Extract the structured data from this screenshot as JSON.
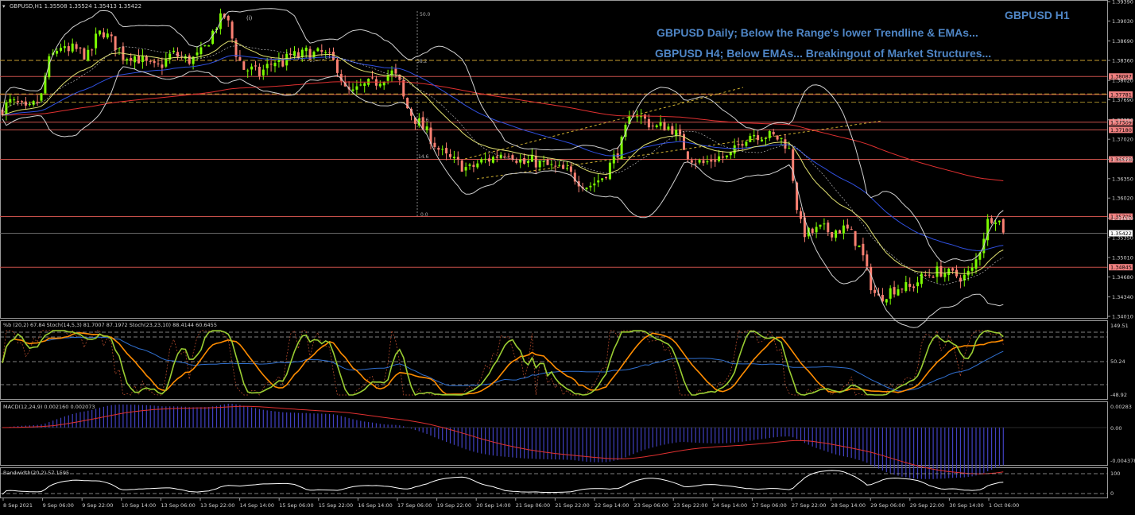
{
  "header": {
    "symbol_line": "GBPUSD,H1  1.35508 1.35524 1.35413 1.35422",
    "title_right": "GBPUSD H1",
    "annotation_1": "GBPUSD Daily; Below the Range's lower Trendline & EMAs...",
    "annotation_2": "GBPUSD H4; Below EMAs... Breakingout of Market Structures..."
  },
  "chart_data": [
    {
      "type": "candlestick",
      "name": "main",
      "ylim": [
        1.3401,
        1.3936
      ],
      "y_ticks": [
        1.3936,
        1.3903,
        1.3869,
        1.3836,
        1.3802,
        1.3769,
        1.3735,
        1.3702,
        1.3668,
        1.3635,
        1.3602,
        1.3568,
        1.3535,
        1.3501,
        1.3468,
        1.3434,
        1.3401
      ],
      "y_tick_labels": [
        "1.39390",
        "1.39030",
        "1.38690",
        "1.38360",
        "1.38020",
        "1.37690",
        "1.37350",
        "1.37020",
        "1.36680",
        "1.36350",
        "1.36020",
        "1.35680",
        "1.35350",
        "1.35010",
        "1.34680",
        "1.34340",
        "1.34010"
      ],
      "price_levels": [
        {
          "label": "1.38087",
          "value": 1.38087
        },
        {
          "label": "1.37781",
          "value": 1.37781
        },
        {
          "label": "1.37309",
          "value": 1.37309
        },
        {
          "label": "1.37180",
          "value": 1.3718
        },
        {
          "label": "1.36678",
          "value": 1.36678
        },
        {
          "label": "1.35705",
          "value": 1.35705
        },
        {
          "label": "1.34845",
          "value": 1.34845
        }
      ],
      "current_price": {
        "label": "1.35422",
        "value": 1.35422
      },
      "fib_labels": [
        "50.0",
        "38.2",
        "23.6",
        "14.6",
        "0.0"
      ],
      "swing_label": "(i)",
      "close_path": [
        [
          0,
          1.375
        ],
        [
          12,
          1.3765
        ],
        [
          24,
          1.376
        ],
        [
          34,
          1.3748
        ],
        [
          44,
          1.3762
        ],
        [
          52,
          1.3775
        ],
        [
          60,
          1.383
        ],
        [
          68,
          1.3848
        ],
        [
          76,
          1.3862
        ],
        [
          84,
          1.3846
        ],
        [
          92,
          1.3856
        ],
        [
          102,
          1.385
        ],
        [
          112,
          1.3842
        ],
        [
          122,
          1.3878
        ],
        [
          130,
          1.3885
        ],
        [
          138,
          1.3872
        ],
        [
          148,
          1.3858
        ],
        [
          156,
          1.3842
        ],
        [
          166,
          1.3846
        ],
        [
          176,
          1.3838
        ],
        [
          186,
          1.3828
        ],
        [
          196,
          1.3822
        ],
        [
          206,
          1.3832
        ],
        [
          216,
          1.3848
        ],
        [
          226,
          1.3842
        ],
        [
          236,
          1.3836
        ],
        [
          246,
          1.384
        ],
        [
          256,
          1.3852
        ],
        [
          266,
          1.388
        ],
        [
          274,
          1.39
        ],
        [
          282,
          1.3912
        ],
        [
          288,
          1.3895
        ],
        [
          296,
          1.3852
        ],
        [
          306,
          1.3822
        ],
        [
          316,
          1.382
        ],
        [
          326,
          1.3812
        ],
        [
          336,
          1.3825
        ],
        [
          346,
          1.3835
        ],
        [
          356,
          1.3832
        ],
        [
          366,
          1.3845
        ],
        [
          376,
          1.3842
        ],
        [
          386,
          1.385
        ],
        [
          396,
          1.3846
        ],
        [
          406,
          1.3848
        ],
        [
          416,
          1.3838
        ],
        [
          426,
          1.3822
        ],
        [
          434,
          1.3785
        ],
        [
          444,
          1.378
        ],
        [
          454,
          1.379
        ],
        [
          464,
          1.3795
        ],
        [
          474,
          1.38
        ],
        [
          484,
          1.381
        ],
        [
          494,
          1.3815
        ],
        [
          502,
          1.38
        ],
        [
          510,
          1.376
        ],
        [
          520,
          1.374
        ],
        [
          530,
          1.3725
        ],
        [
          540,
          1.3708
        ],
        [
          550,
          1.3688
        ],
        [
          560,
          1.3672
        ],
        [
          570,
          1.3665
        ],
        [
          580,
          1.3658
        ],
        [
          590,
          1.365
        ],
        [
          600,
          1.366
        ],
        [
          610,
          1.3666
        ],
        [
          620,
          1.367
        ],
        [
          630,
          1.3678
        ],
        [
          640,
          1.3682
        ],
        [
          650,
          1.367
        ],
        [
          660,
          1.366
        ],
        [
          670,
          1.3665
        ],
        [
          680,
          1.366
        ],
        [
          690,
          1.3656
        ],
        [
          700,
          1.3652
        ],
        [
          710,
          1.3648
        ],
        [
          720,
          1.364
        ],
        [
          730,
          1.363
        ],
        [
          740,
          1.3622
        ],
        [
          750,
          1.363
        ],
        [
          760,
          1.364
        ],
        [
          770,
          1.3665
        ],
        [
          780,
          1.3688
        ],
        [
          790,
          1.3728
        ],
        [
          798,
          1.3752
        ],
        [
          806,
          1.374
        ],
        [
          816,
          1.373
        ],
        [
          826,
          1.3722
        ],
        [
          836,
          1.3725
        ],
        [
          846,
          1.372
        ],
        [
          856,
          1.37
        ],
        [
          866,
          1.3675
        ],
        [
          876,
          1.3665
        ],
        [
          886,
          1.366
        ],
        [
          896,
          1.3668
        ],
        [
          906,
          1.3672
        ],
        [
          916,
          1.367
        ],
        [
          926,
          1.3685
        ],
        [
          936,
          1.3705
        ],
        [
          946,
          1.3712
        ],
        [
          956,
          1.371
        ],
        [
          966,
          1.3708
        ],
        [
          976,
          1.3705
        ],
        [
          986,
          1.37
        ],
        [
          994,
          1.368
        ],
        [
          1000,
          1.361
        ],
        [
          1006,
          1.356
        ],
        [
          1014,
          1.354
        ],
        [
          1024,
          1.3545
        ],
        [
          1034,
          1.355
        ],
        [
          1044,
          1.3545
        ],
        [
          1054,
          1.3548
        ],
        [
          1064,
          1.355
        ],
        [
          1074,
          1.3535
        ],
        [
          1084,
          1.351
        ],
        [
          1094,
          1.346
        ],
        [
          1104,
          1.343
        ],
        [
          1114,
          1.344
        ],
        [
          1124,
          1.3448
        ],
        [
          1134,
          1.3452
        ],
        [
          1144,
          1.3448
        ],
        [
          1154,
          1.346
        ],
        [
          1164,
          1.347
        ],
        [
          1174,
          1.3475
        ],
        [
          1184,
          1.3478
        ],
        [
          1194,
          1.3472
        ],
        [
          1204,
          1.347
        ],
        [
          1214,
          1.3468
        ],
        [
          1224,
          1.348
        ],
        [
          1234,
          1.352
        ],
        [
          1242,
          1.356
        ],
        [
          1250,
          1.3575
        ],
        [
          1256,
          1.3565
        ],
        [
          1262,
          1.355
        ],
        [
          1268,
          1.3542
        ]
      ]
    },
    {
      "type": "line",
      "name": "oscillator",
      "legend": "%b (20,2) 67.84  Stoch(14,5,3) 81.7007 87.1972  Stoch(23,23,10) 88.4144 60.6455",
      "y_tick_labels": [
        "149.51",
        "50.24",
        "-48.92"
      ],
      "ylim": [
        -48.92,
        149.51
      ]
    },
    {
      "type": "histogram",
      "name": "macd",
      "legend": "MACD(12,24,9) 0.002160 0.002073",
      "y_tick_labels": [
        "0.00283",
        "0.00",
        "-0.004378"
      ],
      "ylim": [
        -0.004378,
        0.00283
      ]
    },
    {
      "type": "line",
      "name": "bandwidth",
      "legend": "Bandwidth(20,2) 57.1595",
      "y_tick_labels": [
        "100",
        "0"
      ],
      "ylim": [
        0,
        120
      ]
    }
  ],
  "time_axis": [
    "8 Sep 2021",
    "9 Sep 06:00",
    "9 Sep 22:00",
    "10 Sep 14:00",
    "13 Sep 06:00",
    "13 Sep 22:00",
    "14 Sep 14:00",
    "15 Sep 06:00",
    "15 Sep 22:00",
    "16 Sep 14:00",
    "17 Sep 06:00",
    "19 Sep 22:00",
    "20 Sep 14:00",
    "21 Sep 06:00",
    "21 Sep 22:00",
    "22 Sep 14:00",
    "23 Sep 06:00",
    "23 Sep 22:00",
    "24 Sep 14:00",
    "27 Sep 06:00",
    "27 Sep 22:00",
    "28 Sep 14:00",
    "29 Sep 06:00",
    "29 Sep 22:00",
    "30 Sep 14:00",
    "1 Oct 06:00"
  ],
  "colors": {
    "background": "#000000",
    "bull": "#7cfc00",
    "bear": "#fa8072",
    "level_line": "#c8504a",
    "label_bg": "#f08080",
    "annotation": "#4f86c6",
    "fib": "#888888",
    "ema_slow": "#e03030",
    "ema_mid": "#3050e0",
    "ema_fast": "#e0e070",
    "bands": "#d0d0d0",
    "stoch_main": "#9acd32",
    "stoch_slow": "#ff8c00",
    "macd_hist": "#4040c0",
    "macd_signal": "#e03030",
    "bandwidth_line": "#ffffff"
  }
}
